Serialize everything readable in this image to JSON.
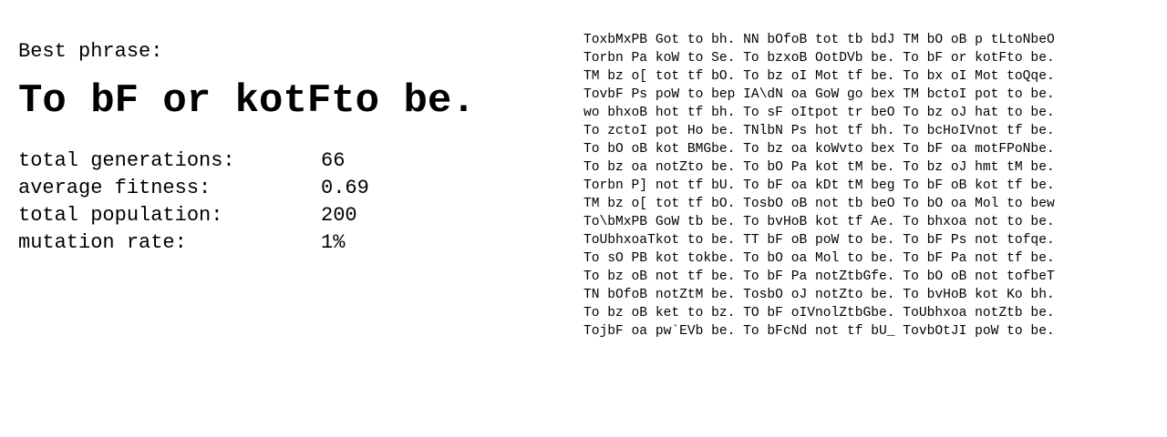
{
  "best": {
    "label": "Best phrase:",
    "phrase": "To bF or kotFto be."
  },
  "stats": [
    {
      "label": "total generations:",
      "value": "66"
    },
    {
      "label": "average fitness:",
      "value": "0.69"
    },
    {
      "label": "total population:",
      "value": "200"
    },
    {
      "label": "mutation rate:",
      "value": "1%"
    }
  ],
  "phrases": [
    "ToxbMxPB Got to bh. NN bOfoB tot tb bdJ TM bO oB p tLtoNbeO",
    "Torbn Pa koW to Se. To bzxoB OotDVb be. To bF or kotFto be.",
    "TM bz o[ tot tf bO. To bz oI Mot tf be. To bx oI Mot toQqe.",
    "TovbF Ps poW to bep IA\\dN oa GoW go bex TM bctoI pot to be.",
    "wo bhxoB hot tf bh. To sF oItpot tr beO To bz oJ hat to be.",
    "To zctoI pot Ho be. TNlbN Ps hot tf bh. To bcHoIVnot tf be.",
    "To bO oB kot BMGbe. To bz oa koWvto bex To bF oa motFPoNbe.",
    "To bz oa notZto be. To bO Pa kot tM be. To bz oJ hmt tM be.",
    "Torbn P] not tf bU. To bF oa kDt tM beg To bF oB kot tf be.",
    "TM bz o[ tot tf bO. TosbO oB not tb beO To bO oa Mol to bew",
    "To\\bMxPB GoW tb be. To bvHoB kot tf Ae. To bhxoa not to be.",
    "ToUbhxoaTkot to be. TT bF oB poW to be. To bF Ps not tofqe.",
    "To sO PB kot tokbe. To bO oa Mol to be. To bF Pa not tf be.",
    "To bz oB not tf be. To bF Pa notZtbGfe. To bO oB not tofbeT",
    "TN bOfoB notZtM be. TosbO oJ notZto be. To bvHoB kot Ko bh.",
    "To bz oB ket to bz. TO bF oIVnolZtbGbe. ToUbhxoa notZtb be.",
    "TojbF oa pw`EVb be. To bFcNd not tf bU_ TovbOtJI poW to be."
  ]
}
